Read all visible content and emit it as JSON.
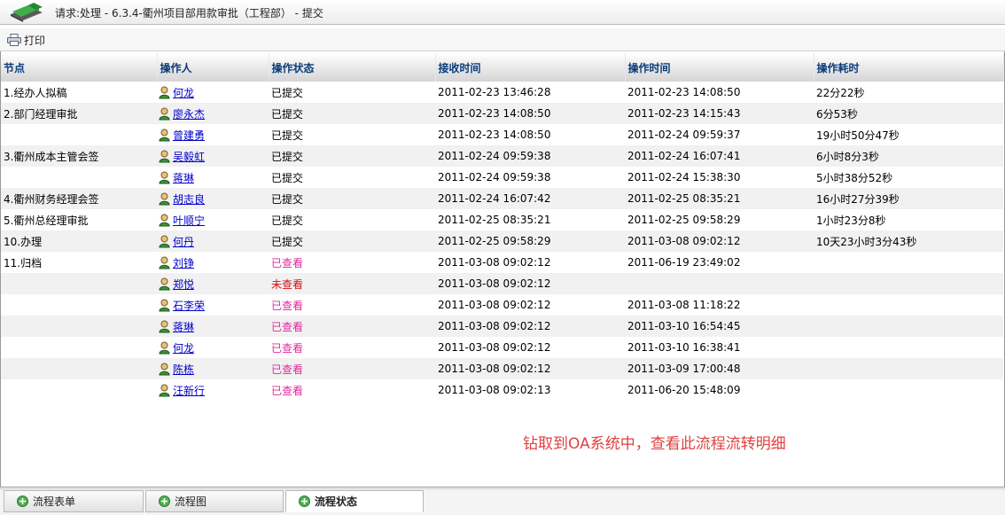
{
  "header": {
    "title": "请求:处理  - 6.3.4-衢州项目部用款审批（工程部） - 提交"
  },
  "toolbar": {
    "print_label": "打印"
  },
  "table": {
    "columns": [
      "节点",
      "操作人",
      "操作状态",
      "接收时间",
      "操作时间",
      "操作耗时"
    ],
    "rows": [
      {
        "node": "1.经办人拟稿",
        "user": "何龙",
        "status": "已提交",
        "status_type": "done",
        "received": "2011-02-23 13:46:28",
        "operated": "2011-02-23 14:08:50",
        "duration": "22分22秒"
      },
      {
        "node": "2.部门经理审批",
        "user": "廖永杰",
        "status": "已提交",
        "status_type": "done",
        "received": "2011-02-23 14:08:50",
        "operated": "2011-02-23 14:15:43",
        "duration": "6分53秒"
      },
      {
        "node": "",
        "user": "曾建勇",
        "status": "已提交",
        "status_type": "done",
        "received": "2011-02-23 14:08:50",
        "operated": "2011-02-24 09:59:37",
        "duration": "19小时50分47秒"
      },
      {
        "node": "3.衢州成本主管会签",
        "user": "吴毅虹",
        "status": "已提交",
        "status_type": "done",
        "received": "2011-02-24 09:59:38",
        "operated": "2011-02-24 16:07:41",
        "duration": "6小时8分3秒"
      },
      {
        "node": "",
        "user": "蒋琳",
        "status": "已提交",
        "status_type": "done",
        "received": "2011-02-24 09:59:38",
        "operated": "2011-02-24 15:38:30",
        "duration": "5小时38分52秒"
      },
      {
        "node": "4.衢州财务经理会签",
        "user": "胡志良",
        "status": "已提交",
        "status_type": "done",
        "received": "2011-02-24 16:07:42",
        "operated": "2011-02-25 08:35:21",
        "duration": "16小时27分39秒"
      },
      {
        "node": "5.衢州总经理审批",
        "user": "叶顺宁",
        "status": "已提交",
        "status_type": "done",
        "received": "2011-02-25 08:35:21",
        "operated": "2011-02-25 09:58:29",
        "duration": "1小时23分8秒"
      },
      {
        "node": "10.办理",
        "user": "何丹",
        "status": "已提交",
        "status_type": "done",
        "received": "2011-02-25 09:58:29",
        "operated": "2011-03-08 09:02:12",
        "duration": "10天23小时3分43秒"
      },
      {
        "node": "11.归档",
        "user": "刘铮",
        "status": "已查看",
        "status_type": "viewed",
        "received": "2011-03-08 09:02:12",
        "operated": "2011-06-19 23:49:02",
        "duration": ""
      },
      {
        "node": "",
        "user": "郑悦",
        "status": "未查看",
        "status_type": "unviewed",
        "received": "2011-03-08 09:02:12",
        "operated": "",
        "duration": ""
      },
      {
        "node": "",
        "user": "石李荣",
        "status": "已查看",
        "status_type": "viewed",
        "received": "2011-03-08 09:02:12",
        "operated": "2011-03-08 11:18:22",
        "duration": ""
      },
      {
        "node": "",
        "user": "蒋琳",
        "status": "已查看",
        "status_type": "viewed",
        "received": "2011-03-08 09:02:12",
        "operated": "2011-03-10 16:54:45",
        "duration": ""
      },
      {
        "node": "",
        "user": "何龙",
        "status": "已查看",
        "status_type": "viewed",
        "received": "2011-03-08 09:02:12",
        "operated": "2011-03-10 16:38:41",
        "duration": ""
      },
      {
        "node": "",
        "user": "陈栋",
        "status": "已查看",
        "status_type": "viewed",
        "received": "2011-03-08 09:02:12",
        "operated": "2011-03-09 17:00:48",
        "duration": ""
      },
      {
        "node": "",
        "user": "汪新行",
        "status": "已查看",
        "status_type": "viewed",
        "received": "2011-03-08 09:02:13",
        "operated": "2011-06-20 15:48:09",
        "duration": ""
      }
    ]
  },
  "annotation": {
    "text": "钻取到OA系统中，查看此流程流转明细"
  },
  "tabs": [
    {
      "label": "流程表单",
      "active": false
    },
    {
      "label": "流程图",
      "active": false
    },
    {
      "label": "流程状态",
      "active": true
    }
  ],
  "colors": {
    "header_text": "#0b3c7a",
    "link": "#0000cc",
    "status_viewed": "#e0299b",
    "status_unviewed": "#d11010",
    "annotation": "#e04040"
  },
  "icons": {
    "app_logo": "book-logo-icon",
    "print": "printer-icon",
    "user": "user-icon",
    "tab": "plus-circle-icon"
  }
}
